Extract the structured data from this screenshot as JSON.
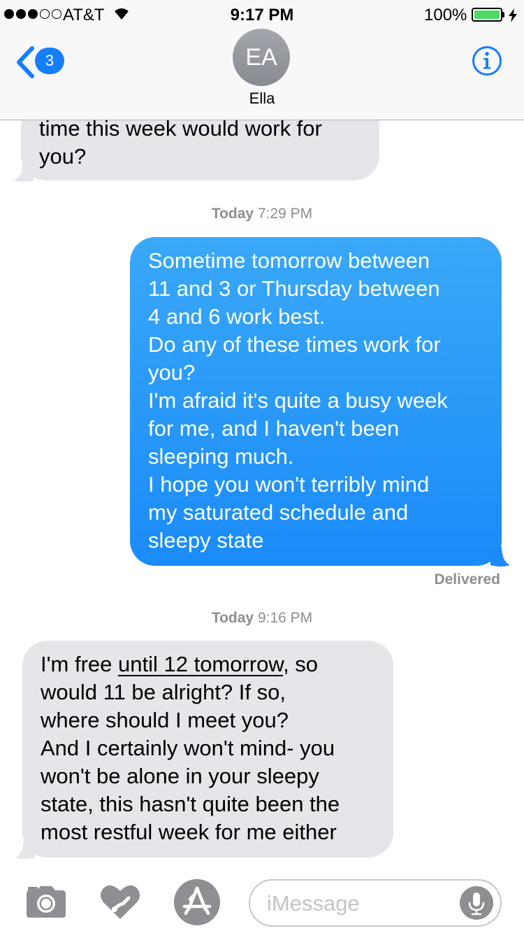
{
  "status_bar": {
    "carrier": "AT&T",
    "time": "9:17 PM",
    "battery_percent": "100%",
    "signal_bars_filled": 3,
    "signal_bars_total": 5
  },
  "header": {
    "back_badge": "3",
    "avatar_initials": "EA",
    "contact_name": "Ella"
  },
  "messages": {
    "incoming_1": {
      "lines": [
        "time this week would work for",
        "you?"
      ]
    },
    "timestamp_1": {
      "day": "Today",
      "time": "7:29 PM"
    },
    "outgoing_1": {
      "lines": [
        "Sometime tomorrow between",
        "11 and 3 or Thursday between",
        "4 and 6 work best.",
        "Do any of these times work for",
        "you?",
        "I'm afraid it's quite a busy week",
        "for me, and I haven't been",
        "sleeping much.",
        "I hope you won't terribly mind",
        "my saturated schedule and",
        "sleepy state"
      ]
    },
    "delivered": "Delivered",
    "timestamp_2": {
      "day": "Today",
      "time": "9:16 PM"
    },
    "incoming_2": {
      "line1_prefix": "I'm free ",
      "line1_link": "until 12 tomorrow",
      "line1_suffix": ", so",
      "lines": [
        "would 11 be alright? If so,",
        "where should I meet you?",
        "And I certainly won't mind- you",
        "won't be alone in your sleepy",
        "state, this hasn't quite been the",
        "most restful week for me either"
      ]
    }
  },
  "input_bar": {
    "placeholder": "iMessage"
  },
  "colors": {
    "accent": "#147efb",
    "outgoing_bubble": "#1a8bf9",
    "incoming_bubble": "#e5e5ea",
    "battery": "#4cd964"
  },
  "icons": [
    "camera-icon",
    "digital-touch-icon",
    "app-store-icon",
    "microphone-icon",
    "info-icon",
    "chevron-left-icon",
    "wifi-icon",
    "bolt-icon"
  ]
}
